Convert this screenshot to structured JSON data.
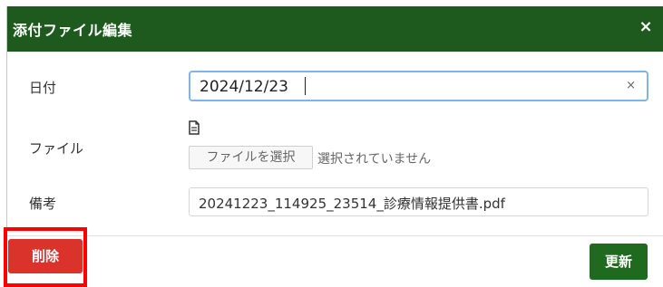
{
  "dialog": {
    "title": "添付ファイル編集",
    "close_label": "×"
  },
  "form": {
    "date": {
      "label": "日付",
      "value": "2024/12/23",
      "clear_label": "×"
    },
    "file": {
      "label": "ファイル",
      "icon": "file-icon",
      "button_label": "ファイルを選択",
      "status": "選択されていません"
    },
    "note": {
      "label": "備考",
      "value": "20241223_114925_23514_診療情報提供書.pdf"
    }
  },
  "footer": {
    "delete_label": "削除",
    "update_label": "更新"
  },
  "colors": {
    "header": "#1e5a1e",
    "delete": "#d9332c",
    "update": "#1f6a1f",
    "focus_border": "#7fb6e8",
    "highlight": "#ff0000"
  }
}
